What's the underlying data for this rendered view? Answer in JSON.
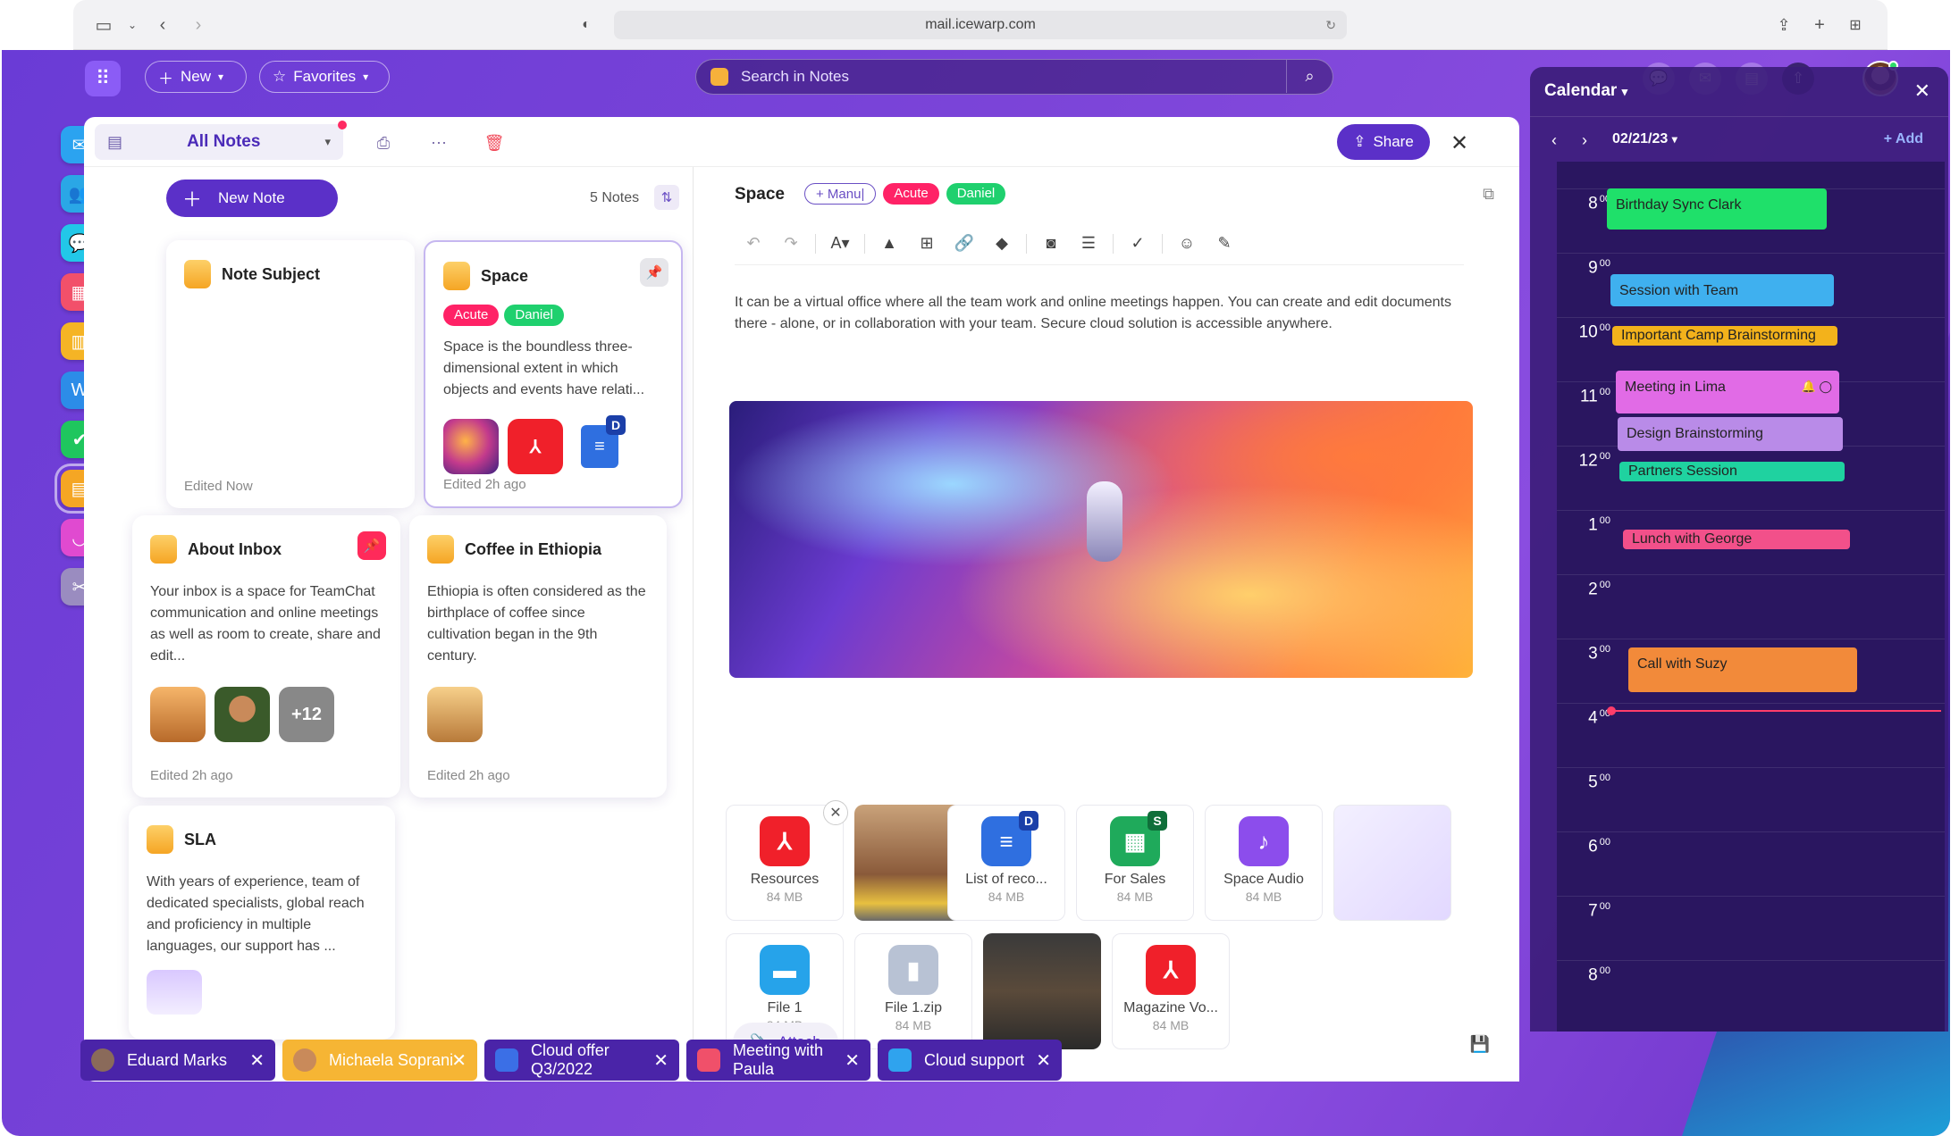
{
  "browser": {
    "url": "mail.icewarp.com"
  },
  "topbar": {
    "new_label": "New",
    "favorites_label": "Favorites",
    "search_placeholder": "Search in Notes"
  },
  "notes_panel": {
    "folder": "All Notes",
    "share_label": "Share",
    "new_note_label": "New Note",
    "count_label": "5 Notes"
  },
  "notes": [
    {
      "title": "Note Subject",
      "body": "",
      "edited": "Edited Now"
    },
    {
      "title": "Space",
      "tags": [
        "Acute",
        "Daniel"
      ],
      "body": "Space is the boundless three-dimensional extent in which objects and events have relati...",
      "edited": "Edited 2h ago",
      "thumb_badge": "D"
    },
    {
      "title": "About Inbox",
      "body": "Your inbox is a space for TeamChat communication and online meetings as well as room to create, share and edit...",
      "edited": "Edited 2h ago",
      "more_count": "+12"
    },
    {
      "title": "Coffee in Ethiopia",
      "body": "Ethiopia is often considered as the birthplace of coffee since cultivation began in the 9th century.",
      "edited": "Edited 2h ago"
    },
    {
      "title": "SLA",
      "body": "With years of experience, team of dedicated specialists, global reach and proficiency in multiple languages, our support has ..."
    }
  ],
  "editor": {
    "title": "Space",
    "tag_input": "+ Manu|",
    "tags": [
      "Acute",
      "Daniel"
    ],
    "body": "It can be a virtual office where all the team work and online meetings happen. You can create and edit documents there - alone, or in collaboration with your team. Secure cloud solution is accessible anywhere.",
    "attach_label": "Attach"
  },
  "attachments": [
    {
      "name": "Resources",
      "size": "84 MB",
      "icon": "pdf-icon",
      "color": "#f0202a",
      "glyph": "⅄"
    },
    {
      "name": "List of reco...",
      "size": "84 MB",
      "icon": "docs-icon",
      "color": "#2f6fe0",
      "glyph": "≡",
      "badge": "D"
    },
    {
      "name": "For Sales",
      "size": "84 MB",
      "icon": "sheets-icon",
      "color": "#1faa5b",
      "glyph": "▦",
      "badge": "S"
    },
    {
      "name": "Space Audio",
      "size": "84 MB",
      "icon": "audio-icon",
      "color": "#8c4dec",
      "glyph": "|||"
    },
    {
      "name": "File 1",
      "size": "84 MB",
      "icon": "folder-icon",
      "color": "#26a3ea",
      "glyph": "▬"
    },
    {
      "name": "File 1.zip",
      "size": "84 MB",
      "icon": "zip-icon",
      "color": "#b8c2d4",
      "glyph": "▮"
    },
    {
      "name": "Magazine Vo...",
      "size": "84 MB",
      "icon": "pdf-icon",
      "color": "#f0202a",
      "glyph": "⅄"
    }
  ],
  "calendar": {
    "title": "Calendar",
    "date": "02/21/23",
    "add_label": "+ Add",
    "hours": [
      {
        "h": "8",
        "m": "00"
      },
      {
        "h": "9",
        "m": "00"
      },
      {
        "h": "10",
        "m": "00"
      },
      {
        "h": "11",
        "m": "00"
      },
      {
        "h": "12",
        "m": "00"
      },
      {
        "h": "1",
        "m": "00"
      },
      {
        "h": "2",
        "m": "00"
      },
      {
        "h": "3",
        "m": "00"
      },
      {
        "h": "4",
        "m": "00"
      },
      {
        "h": "5",
        "m": "00"
      },
      {
        "h": "6",
        "m": "00"
      },
      {
        "h": "7",
        "m": "00"
      },
      {
        "h": "8",
        "m": "00"
      }
    ],
    "events": [
      {
        "title": "Birthday Sync Clark",
        "color": "#1fe06a"
      },
      {
        "title": "Session with Team",
        "color": "#3fb0ef"
      },
      {
        "title": "Important Camp Brainstorming",
        "color": "#f3b21b"
      },
      {
        "title": "Meeting in Lima",
        "color": "#e16be6"
      },
      {
        "title": "Design Brainstorming",
        "color": "#b98be8"
      },
      {
        "title": "Partners Session",
        "color": "#1fd2a0"
      },
      {
        "title": "Lunch with George",
        "color": "#f2508a"
      },
      {
        "title": "Call with Suzy",
        "color": "#f28a3a"
      }
    ]
  },
  "taskbar": [
    {
      "label": "Eduard Marks",
      "icon": "avatar-icon",
      "color": "#8a6a5a"
    },
    {
      "label": "Michaela Soprani",
      "icon": "avatar-icon",
      "color": "#c98a5a"
    },
    {
      "label": "Cloud offer Q3/2022",
      "icon": "document-icon",
      "color": "#3b6fe6"
    },
    {
      "label": "Meeting with Paula",
      "icon": "calendar-icon",
      "color": "#f0506a"
    },
    {
      "label": "Cloud support",
      "icon": "mail-icon",
      "color": "#2fa3ee"
    }
  ]
}
